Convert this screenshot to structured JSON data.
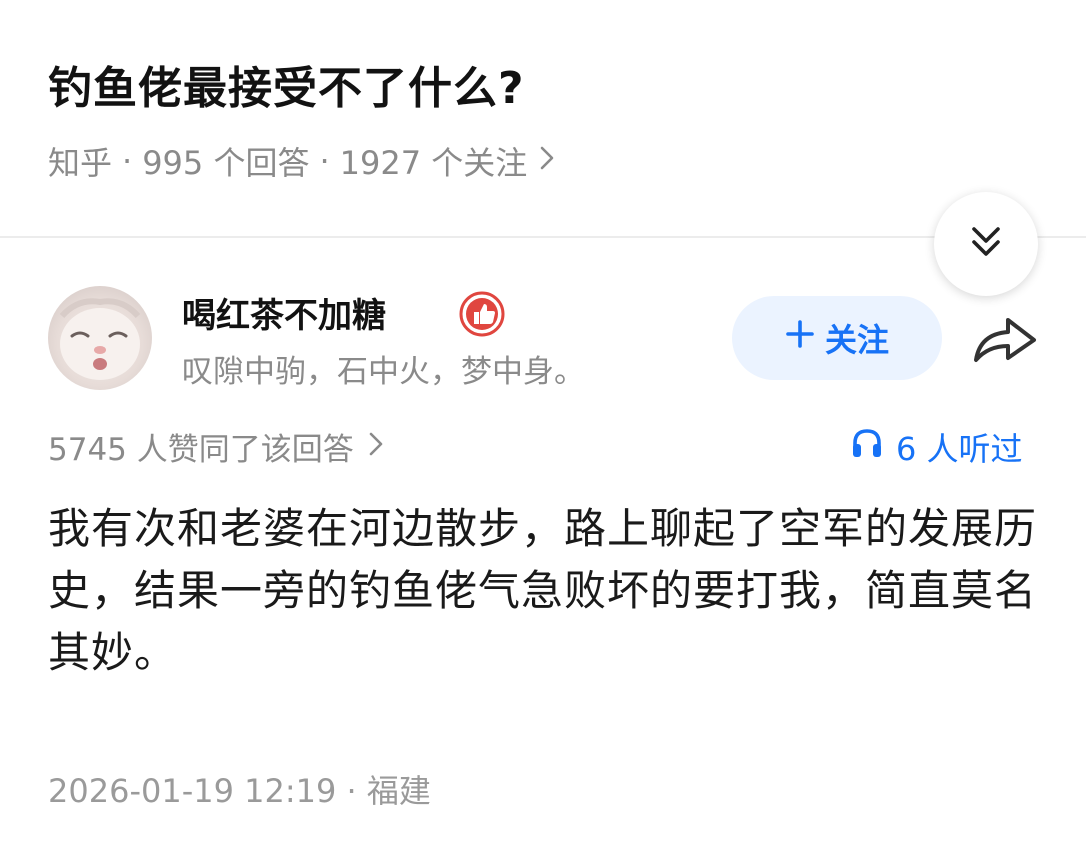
{
  "question": {
    "title": "钓鱼佬最接受不了什么?",
    "source": "知乎",
    "separator": "·",
    "answers": "995 个回答",
    "followers": "1927 个关注"
  },
  "author": {
    "name": "喝红茶不加糖",
    "bio": "叹隙中驹，石中火，梦中身。",
    "follow_label": "关注"
  },
  "answer": {
    "upvotes": "5745 人赞同了该回答",
    "listened": "6 人听过",
    "content": "我有次和老婆在河边散步，路上聊起了空军的发展历史，结果一旁的钓鱼佬气急败坏的要打我，简直莫名其妙。",
    "date_line": "2026-01-19 12:19 · 福建"
  },
  "icons": {
    "chevron": "chevron-right-icon",
    "collapse": "double-chevron-down-icon",
    "badge": "thumbs-up-badge-icon",
    "share": "share-arrow-icon",
    "listen": "headphones-icon",
    "follow": "plus-icon"
  },
  "colors": {
    "accent_blue": "#1772f6",
    "follow_bg": "#ebf3ff",
    "badge_red": "#e0463f",
    "muted_text": "#8a8a8a"
  }
}
